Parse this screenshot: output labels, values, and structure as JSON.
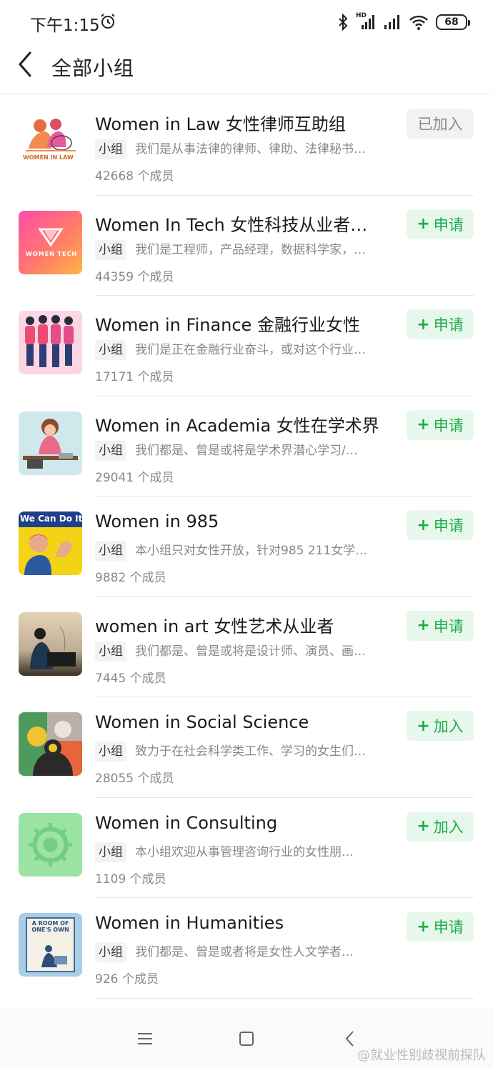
{
  "status_bar": {
    "time": "下午1:15",
    "signal_label": "HD",
    "battery": "68"
  },
  "header": {
    "title": "全部小组"
  },
  "groups": [
    {
      "name": "Women in Law 女性律师互助组",
      "tag": "小组",
      "desc": "我们是从事法律的律师、律助、法律秘书…",
      "members": "42668 个成员",
      "action": "已加入",
      "joined": true,
      "thumb_text": "WOMEN IN LAW"
    },
    {
      "name": "Women In Tech 女性科技从业者…",
      "tag": "小组",
      "desc": "我们是工程师，产品经理，数据科学家，…",
      "members": "44359 个成员",
      "action_plus": "+",
      "action": "申请",
      "thumb_text": "WOMEN TECH"
    },
    {
      "name": "Women in Finance 金融行业女性",
      "tag": "小组",
      "desc": "我们是正在金融行业奋斗，或对这个行业…",
      "members": "17171 个成员",
      "action_plus": "+",
      "action": "申请"
    },
    {
      "name": "Women in Academia 女性在学术界",
      "tag": "小组",
      "desc": "我们都是、曾是或将是学术界潜心学习/…",
      "members": "29041 个成员",
      "action_plus": "+",
      "action": "申请"
    },
    {
      "name": "Women in 985",
      "tag": "小组",
      "desc": "本小组只对女性开放，针对985 211女学…",
      "members": "9882 个成员",
      "action_plus": "+",
      "action": "申请",
      "thumb_text": "We Can Do It!"
    },
    {
      "name": "women in art 女性艺术从业者",
      "tag": "小组",
      "desc": "我们都是、曾是或将是设计师、演员、画…",
      "members": "7445 个成员",
      "action_plus": "+",
      "action": "申请"
    },
    {
      "name": "Women in Social Science",
      "tag": "小组",
      "desc": "致力于在社会科学类工作、学习的女生们…",
      "members": "28055 个成员",
      "action_plus": "+",
      "action": "加入"
    },
    {
      "name": "Women in Consulting",
      "tag": "小组",
      "desc": "本小组欢迎从事管理咨询行业的女性朋…",
      "members": "1109 个成员",
      "action_plus": "+",
      "action": "加入"
    },
    {
      "name": "Women in Humanities",
      "tag": "小组",
      "desc": "我们都是、曾是或者将是女性人文学者…",
      "members": "926 个成员",
      "action_plus": "+",
      "action": "申请",
      "thumb_text": "A ROOM OF ONE'S OWN"
    }
  ],
  "watermark": "@就业性别歧视前探队",
  "colors": {
    "accent_green": "#1aad48",
    "button_bg": "#e8f7ec"
  }
}
